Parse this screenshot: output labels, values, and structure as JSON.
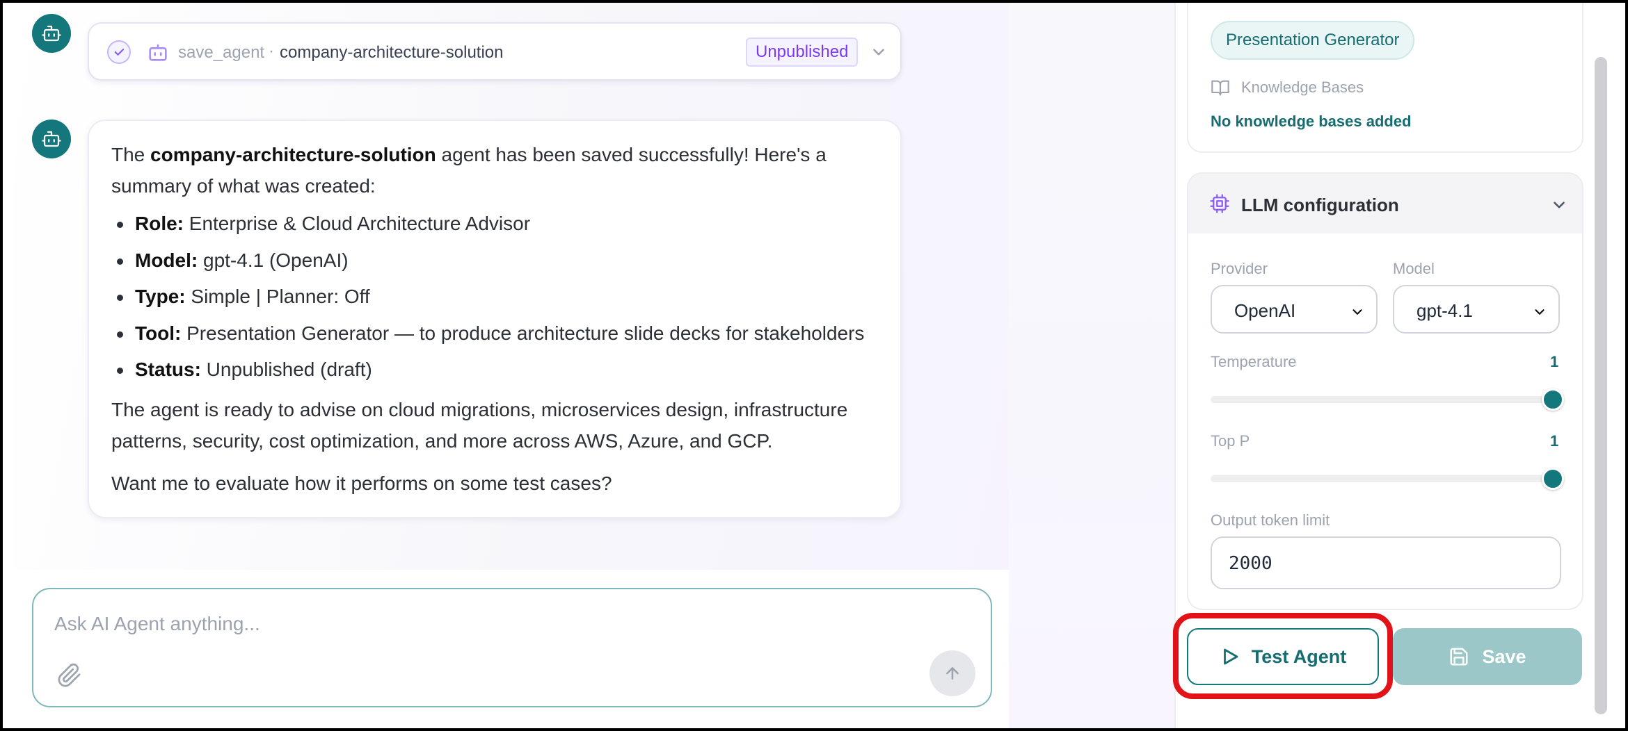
{
  "chat": {
    "tool_call": {
      "tool_name": "save_agent",
      "separator": "·",
      "target": "company-architecture-solution",
      "status_badge": "Unpublished"
    },
    "message": {
      "intro_prefix": "The ",
      "agent_name": "company-architecture-solution",
      "intro_suffix": " agent has been saved successfully! Here's a summary of what was created:",
      "items": [
        {
          "label": "Role:",
          "value": " Enterprise & Cloud Architecture Advisor"
        },
        {
          "label": "Model:",
          "value": " gpt-4.1 (OpenAI)"
        },
        {
          "label": "Type:",
          "value": " Simple | Planner: Off"
        },
        {
          "label": "Tool:",
          "value": " Presentation Generator — to produce architecture slide decks for stakeholders"
        },
        {
          "label": "Status:",
          "value": " Unpublished (draft)"
        }
      ],
      "paragraph": "The agent is ready to advise on cloud migrations, microservices design, infrastructure patterns, security, cost optimization, and more across AWS, Azure, and GCP.",
      "closing": "Want me to evaluate how it performs on some test cases?"
    },
    "input": {
      "placeholder": "Ask AI Agent anything...",
      "value": ""
    }
  },
  "panel": {
    "tools": {
      "chip": "Presentation Generator"
    },
    "knowledge_bases": {
      "label": "Knowledge Bases",
      "empty_text": "No knowledge bases added"
    },
    "llm": {
      "title": "LLM configuration",
      "provider_label": "Provider",
      "provider_value": "OpenAI",
      "model_label": "Model",
      "model_value": "gpt-4.1",
      "temperature_label": "Temperature",
      "temperature_value": "1",
      "top_p_label": "Top P",
      "top_p_value": "1",
      "token_limit_label": "Output token limit",
      "token_limit_value": "2000"
    },
    "actions": {
      "test_label": "Test Agent",
      "save_label": "Save"
    }
  },
  "colors": {
    "accent": "#13777c",
    "accent_text": "#156d71",
    "badge_purple": "#7c3aed",
    "save_disabled": "#9cc7c9",
    "highlight": "#e11218"
  },
  "icons": [
    "bot-icon",
    "check-icon",
    "chevron-down-icon",
    "paperclip-icon",
    "arrow-up-icon",
    "book-icon",
    "cpu-icon",
    "play-icon",
    "floppy-disk-icon"
  ]
}
